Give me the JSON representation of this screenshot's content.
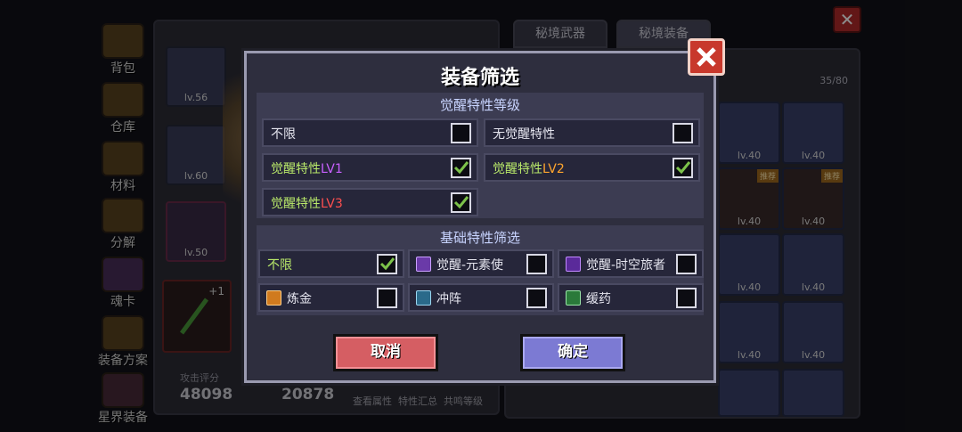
{
  "background": {
    "nav": [
      "背包",
      "仓库",
      "材料",
      "分解",
      "魂卡",
      "装备方案",
      "星界装备"
    ],
    "hero_slot_levels": [
      "lv.56",
      "lv.60",
      "lv.50"
    ],
    "weapon_plus": "+1",
    "attack_label": "攻击评分",
    "attack_value": "48098",
    "defense_value": "20878",
    "sub_tabs": [
      "查看属性",
      "特性汇总",
      "共鸣等级"
    ],
    "tabs": [
      "秘境武器",
      "秘境装备"
    ],
    "inventory_count": "35/80",
    "inventory_levels": [
      "lv.40",
      "lv.40",
      "lv.40",
      "lv.40",
      "lv.40",
      "lv.40",
      "lv.40",
      "lv.40"
    ],
    "recommend_badge": "推荐"
  },
  "modal": {
    "title": "装备筛选",
    "section1_title": "觉醒特性等级",
    "section2_title": "基础特性筛选",
    "awaken": {
      "unlimited": "不限",
      "none": "无觉醒特性",
      "prefix": "觉醒特性",
      "lv1": "LV1",
      "lv2": "LV2",
      "lv3": "LV3"
    },
    "basic": {
      "unlimited": "不限",
      "elemental": "觉醒-元素使",
      "timetraveler": "觉醒-时空旅者",
      "alchemy": "炼金",
      "charge": "冲阵",
      "potion": "缓药"
    },
    "cancel": "取消",
    "confirm": "确定"
  },
  "colors": {
    "modal_bg": "#2e2e3e",
    "cancel": "#d55e63",
    "confirm": "#7c7ad3",
    "close": "#c8382c",
    "green_text": "#b9e96a",
    "lv1": "#c860ff",
    "lv2": "#ffa52e",
    "lv3": "#ff4f4f"
  }
}
